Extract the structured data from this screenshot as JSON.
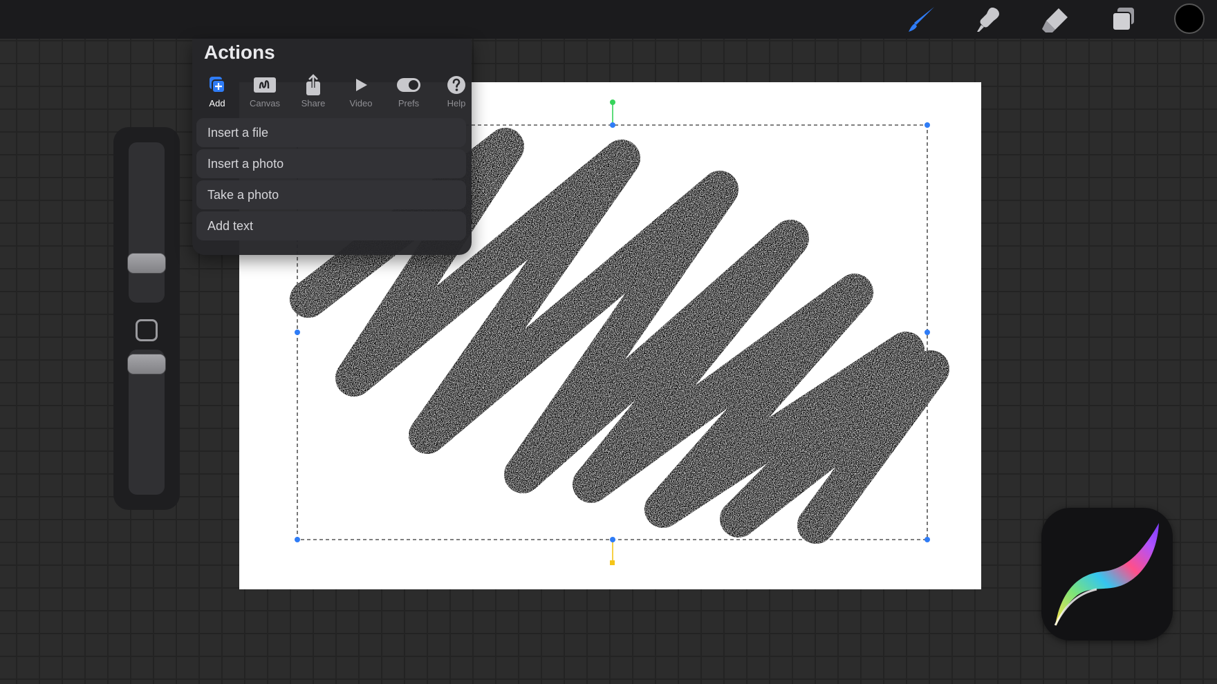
{
  "toolbar": {
    "tools": [
      {
        "icon": "brush-icon",
        "active": true
      },
      {
        "icon": "smudge-icon",
        "active": false
      },
      {
        "icon": "eraser-icon",
        "active": false
      },
      {
        "icon": "layers-icon",
        "active": false
      }
    ],
    "current_color": "#000000",
    "accent_color": "#2f7cf6"
  },
  "sidebar": {
    "brush_size": 0.68,
    "brush_opacity": 0.72,
    "modify_button_icon": "square-icon"
  },
  "actions_panel": {
    "title": "Actions",
    "tabs": [
      {
        "label": "Add",
        "icon": "add-icon",
        "active": true
      },
      {
        "label": "Canvas",
        "icon": "canvas-icon",
        "active": false
      },
      {
        "label": "Share",
        "icon": "share-icon",
        "active": false
      },
      {
        "label": "Video",
        "icon": "play-icon",
        "active": false
      },
      {
        "label": "Prefs",
        "icon": "toggle-icon",
        "active": false
      },
      {
        "label": "Help",
        "icon": "help-icon",
        "active": false
      }
    ],
    "items": [
      {
        "label": "Insert a file"
      },
      {
        "label": "Insert a photo"
      },
      {
        "label": "Take a photo"
      },
      {
        "label": "Add text"
      }
    ]
  },
  "canvas": {
    "background": "#ffffff",
    "stroke_color": "#000000",
    "selection_handle_color": "#2f7cf6",
    "rotation_handle_color": "#36d45a",
    "snap_handle_color": "#f5c518"
  },
  "app_logo": {
    "icon": "procreate-logo-icon"
  }
}
